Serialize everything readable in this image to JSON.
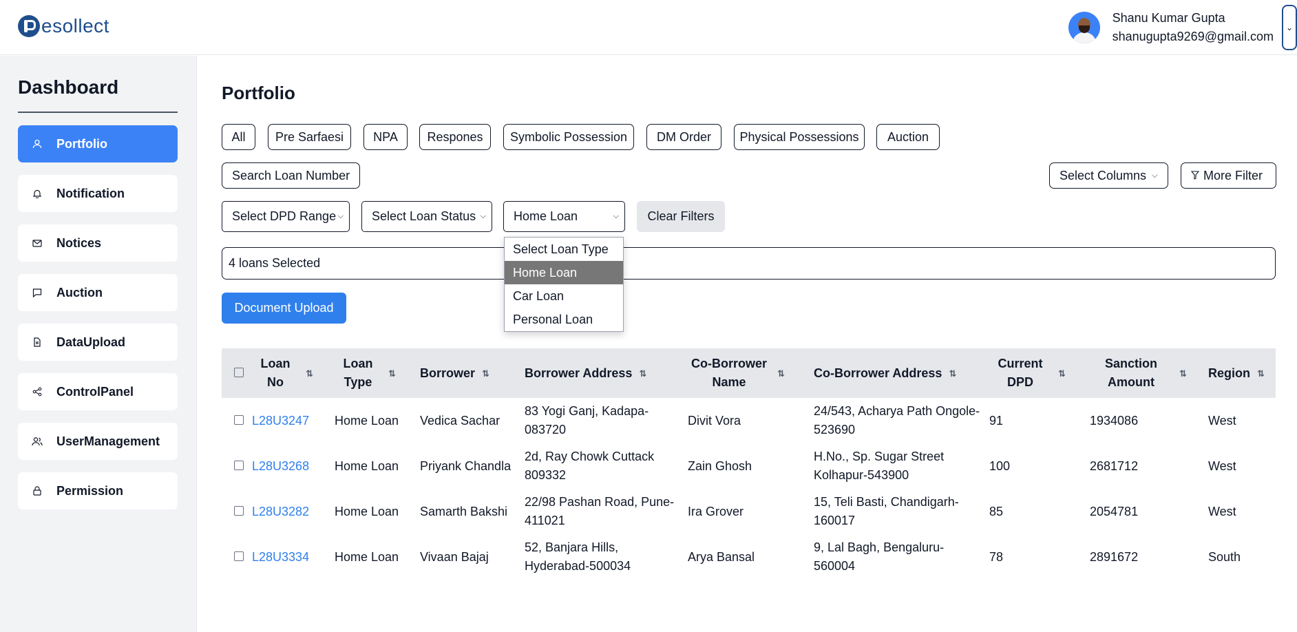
{
  "header": {
    "logo_text": "esollect",
    "user_name": "Shanu Kumar Gupta",
    "user_email": "shanugupta9269@gmail.com"
  },
  "sidebar": {
    "title": "Dashboard",
    "items": [
      {
        "label": "Portfolio",
        "icon": "user-icon"
      },
      {
        "label": "Notification",
        "icon": "bell-icon"
      },
      {
        "label": "Notices",
        "icon": "mail-icon"
      },
      {
        "label": "Auction",
        "icon": "message-icon"
      },
      {
        "label": "DataUpload",
        "icon": "file-icon"
      },
      {
        "label": "ControlPanel",
        "icon": "share-icon"
      },
      {
        "label": "UserManagement",
        "icon": "users-icon"
      },
      {
        "label": "Permission",
        "icon": "lock-icon"
      }
    ]
  },
  "main": {
    "title": "Portfolio",
    "filters": [
      "All",
      "Pre Sarfaesi",
      "NPA",
      "Respones",
      "Symbolic Possession",
      "DM Order",
      "Physical Possessions",
      "Auction"
    ],
    "search_label": "Search Loan Number",
    "select_columns": "Select Columns",
    "more_filter": "More Filter",
    "dpd_select": "Select DPD Range",
    "status_select": "Select Loan Status",
    "type_select": "Home Loan",
    "clear_filters": "Clear Filters",
    "selected_text": "4 loans Selected",
    "document_upload": "Document Upload",
    "type_options": [
      "Select Loan Type",
      "Home Loan",
      "Car Loan",
      "Personal Loan"
    ]
  },
  "table": {
    "headers": [
      "Loan No",
      "Loan Type",
      "Borrower",
      "Borrower Address",
      "Co-Borrower Name",
      "Co-Borrower Address",
      "Current DPD",
      "Sanction Amount",
      "Region"
    ],
    "rows": [
      {
        "loan_no": "L28U3247",
        "type": "Home Loan",
        "borrower": "Vedica Sachar",
        "address": "83 Yogi Ganj, Kadapa-083720",
        "co_name": "Divit Vora",
        "co_address": "24/543, Acharya Path Ongole-523690",
        "dpd": "91",
        "amount": "1934086",
        "region": "West"
      },
      {
        "loan_no": "L28U3268",
        "type": "Home Loan",
        "borrower": "Priyank Chandla",
        "address": "2d, Ray Chowk Cuttack 809332",
        "co_name": "Zain Ghosh",
        "co_address": "H.No., Sp. Sugar Street Kolhapur-543900",
        "dpd": "100",
        "amount": "2681712",
        "region": "West"
      },
      {
        "loan_no": "L28U3282",
        "type": "Home Loan",
        "borrower": "Samarth Bakshi",
        "address": "22/98 Pashan Road, Pune-411021",
        "co_name": "Ira Grover",
        "co_address": "15, Teli Basti, Chandigarh-160017",
        "dpd": "85",
        "amount": "2054781",
        "region": "West"
      },
      {
        "loan_no": "L28U3334",
        "type": "Home Loan",
        "borrower": "Vivaan Bajaj",
        "address": "52, Banjara Hills, Hyderabad-500034",
        "co_name": "Arya Bansal",
        "co_address": "9, Lal Bagh, Bengaluru-560004",
        "dpd": "78",
        "amount": "2891672",
        "region": "South"
      }
    ]
  },
  "colors": {
    "primary": "#3b82f6",
    "brand": "#1f4e8c",
    "link": "#2f80ed"
  }
}
